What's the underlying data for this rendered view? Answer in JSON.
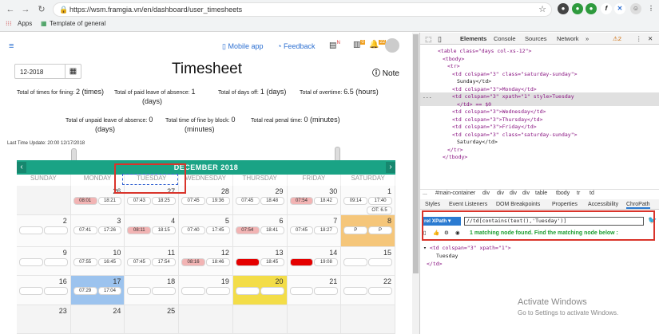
{
  "browser": {
    "url": "https://wsm.framgia.vn/en/dashboard/user_timesheets",
    "bookmarks": [
      "Apps",
      "Template of general"
    ]
  },
  "header": {
    "mobile_app": "Mobile app",
    "feedback": "Feedback",
    "badge_n": "N",
    "badge_count1": "0",
    "badge_count2": "22"
  },
  "filter": {
    "month": "12-2018"
  },
  "title": "Timesheet",
  "note": "Note",
  "stats": {
    "finning_label": "Total of times for fining:",
    "finning_value": "2 (times)",
    "paid_leave_label": "Total of paid leave of absence:",
    "paid_leave_value": "1",
    "paid_leave_unit": "(days)",
    "days_off_label": "Total of days off:",
    "days_off_value": "1 (days)",
    "overtime_label": "Total of overtime:",
    "overtime_value": "6.5 (hours)",
    "unpaid_leave_label": "Total of unpaid leave of absence:",
    "unpaid_leave_value": "0",
    "unpaid_leave_unit": "(days)",
    "fine_block_label": "Total time of fine by block:",
    "fine_block_value": "0",
    "fine_block_unit": "(minutes)",
    "penal_label": "Total real penal time:",
    "penal_value": "0 (minutes)"
  },
  "last_update": "Last Time Update: 20:00 12/17/2018",
  "calendar": {
    "title": "DECEMBER 2018",
    "prev": "‹",
    "next": "›",
    "days": [
      "SUNDAY",
      "MONDAY",
      "TUESDAY",
      "WEDNESDAY",
      "THURSDAY",
      "FRIDAY",
      "SATURDAY"
    ],
    "weeks": [
      [
        {
          "d": "",
          "in": "",
          "out": "",
          "style": "none"
        },
        {
          "d": "26",
          "in": "08:01",
          "out": "18:21",
          "style": "red"
        },
        {
          "d": "27",
          "in": "07:43",
          "out": "18:25",
          "style": "plain"
        },
        {
          "d": "28",
          "in": "07:45",
          "out": "19:36",
          "style": "plain"
        },
        {
          "d": "29",
          "in": "07:45",
          "out": "18:48",
          "style": "plain"
        },
        {
          "d": "30",
          "in": "07:54",
          "out": "18:42",
          "style": "red"
        },
        {
          "d": "1",
          "in": "09:14",
          "out": "17:40",
          "style": "plain",
          "extra": "OT: 6.5"
        }
      ],
      [
        {
          "d": "2",
          "in": "",
          "out": "",
          "style": "empty"
        },
        {
          "d": "3",
          "in": "07:41",
          "out": "17:26",
          "style": "plain"
        },
        {
          "d": "4",
          "in": "08:11",
          "out": "18:15",
          "style": "red"
        },
        {
          "d": "5",
          "in": "07:40",
          "out": "17:45",
          "style": "plain"
        },
        {
          "d": "6",
          "in": "07:54",
          "out": "18:41",
          "style": "red"
        },
        {
          "d": "7",
          "in": "07:45",
          "out": "18:27",
          "style": "plain"
        },
        {
          "d": "8",
          "in": "P",
          "out": "P",
          "style": "orange"
        }
      ],
      [
        {
          "d": "9",
          "in": "",
          "out": "",
          "style": "empty"
        },
        {
          "d": "10",
          "in": "07:55",
          "out": "16:45",
          "style": "plain"
        },
        {
          "d": "11",
          "in": "07:45",
          "out": "17:54",
          "style": "plain"
        },
        {
          "d": "12",
          "in": "08:16",
          "out": "18:46",
          "style": "red"
        },
        {
          "d": "13",
          "in": "",
          "out": "18:45",
          "style": "strong"
        },
        {
          "d": "14",
          "in": "",
          "out": "19:08",
          "style": "strong"
        },
        {
          "d": "15",
          "in": "",
          "out": "",
          "style": "empty"
        }
      ],
      [
        {
          "d": "16",
          "in": "",
          "out": "",
          "style": "empty"
        },
        {
          "d": "17",
          "in": "07:29",
          "out": "17:04",
          "style": "today"
        },
        {
          "d": "18",
          "in": "",
          "out": "",
          "style": "empty"
        },
        {
          "d": "19",
          "in": "",
          "out": "",
          "style": "empty"
        },
        {
          "d": "20",
          "in": "",
          "out": "",
          "style": "yellow"
        },
        {
          "d": "21",
          "in": "",
          "out": "",
          "style": "empty"
        },
        {
          "d": "22",
          "in": "",
          "out": "",
          "style": "empty"
        }
      ],
      [
        {
          "d": "23",
          "in": "",
          "out": "",
          "style": "none"
        },
        {
          "d": "24",
          "in": "",
          "out": "",
          "style": "none"
        },
        {
          "d": "25",
          "in": "",
          "out": "",
          "style": "none"
        },
        {
          "d": "",
          "in": "",
          "out": "",
          "style": "none"
        },
        {
          "d": "",
          "in": "",
          "out": "",
          "style": "none"
        },
        {
          "d": "",
          "in": "",
          "out": "",
          "style": "none"
        },
        {
          "d": "",
          "in": "",
          "out": "",
          "style": "none"
        }
      ]
    ]
  },
  "devtools": {
    "tabs": [
      "Elements",
      "Console",
      "Sources",
      "Network"
    ],
    "warn_count": "2",
    "dom_lines": [
      "<table class=\"days col-xs-12\">",
      "<tbody>",
      "<tr>",
      "<td colspan=\"3\" class=\"saturday-sunday\">",
      "Sunday</td>",
      "<td colspan=\"3\">Monday</td>",
      "<td colspan=\"3\" xpath=\"1\" style>Tuesday",
      "</td> == $0",
      "<td colspan=\"3\">Wednesday</td>",
      "<td colspan=\"3\">Thursday</td>",
      "<td colspan=\"3\">Friday</td>",
      "<td colspan=\"3\" class=\"saturday-sunday\">",
      "Saturday</td>",
      "</tr>",
      "</tbody>"
    ],
    "breadcrumbs": [
      "...",
      "#main-container",
      "div",
      "div",
      "div",
      "div",
      "table",
      "tbody",
      "tr",
      "td"
    ],
    "subtabs": [
      "Styles",
      "Event Listeners",
      "DOM Breakpoints",
      "Properties",
      "Accessibility",
      "ChroPath"
    ],
    "chropath": {
      "selector_type": "rel XPath",
      "xpath": "//td[contains(text(),'Tuesday')]",
      "match_text": "1 matching node found. Find the matching node below :",
      "node_lines": [
        "<td colspan=\"3\" xpath=\"1\">",
        "Tuesday",
        "</td>"
      ]
    }
  },
  "watermark": {
    "title": "Activate Windows",
    "subtitle": "Go to Settings to activate Windows."
  }
}
